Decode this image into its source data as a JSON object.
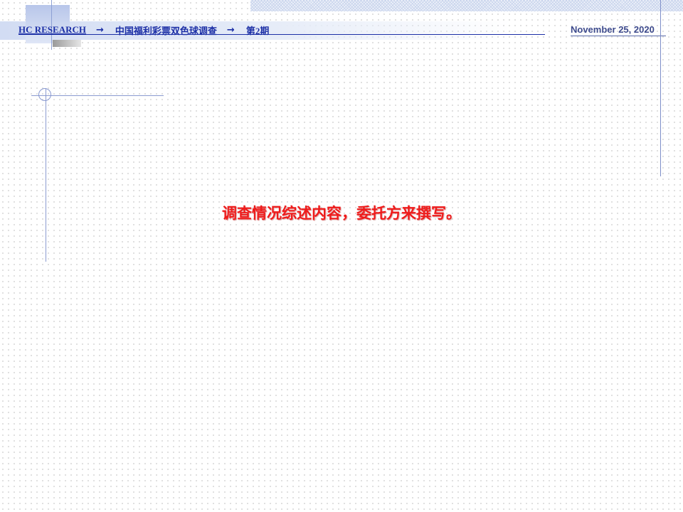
{
  "header": {
    "brand": "HC RESEARCH",
    "arrow_1": "→",
    "report_title": "中国福利彩票双色球调查",
    "arrow_2": "→",
    "issue": "第2期",
    "date": "November 25, 2020"
  },
  "body": {
    "text": "调查情况综述内容，委托方来撰写。"
  },
  "colors": {
    "header_text": "#1c2fa6",
    "date_text": "#3d4a8c",
    "body_text": "#ef1b1b",
    "accent_line": "#8a9ad0"
  }
}
